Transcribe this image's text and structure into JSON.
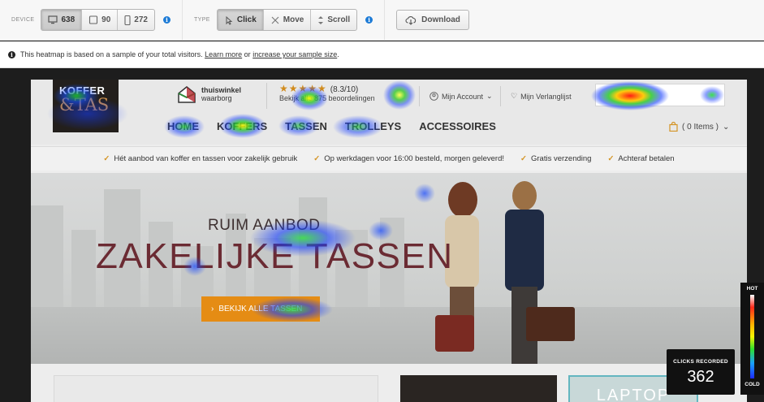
{
  "toolbar": {
    "device": {
      "label": "DEVICE",
      "options": [
        {
          "icon": "desktop-icon",
          "count": "638",
          "active": true
        },
        {
          "icon": "tablet-icon",
          "count": "90",
          "active": false
        },
        {
          "icon": "mobile-icon",
          "count": "272",
          "active": false
        }
      ]
    },
    "type": {
      "label": "TYPE",
      "options": [
        {
          "icon": "click-icon",
          "label": "Click",
          "active": true
        },
        {
          "icon": "move-icon",
          "label": "Move",
          "active": false
        },
        {
          "icon": "scroll-icon",
          "label": "Scroll",
          "active": false
        }
      ]
    },
    "download": {
      "icon": "cloud-download-icon",
      "label": "Download"
    }
  },
  "notice": {
    "text_before": "This heatmap is based on a sample of your total visitors.",
    "link1": "Learn more",
    "text_mid": "or",
    "link2": "increase your sample size",
    "text_after": "."
  },
  "site": {
    "logo_line1": "KOFFER",
    "logo_line2": "&TAS",
    "trust_line1": "thuiswinkel",
    "trust_line2": "waarborg",
    "rating_stars": "★★★★★",
    "rating_score": "(8.3/10)",
    "rating_sub": "Bekijk alle 875 beoordelingen",
    "account": "Mijn Account",
    "wishlist": "Mijn Verlanglijst",
    "nav": [
      "HOME",
      "KOFFERS",
      "TASSEN",
      "TROLLEYS",
      "ACCESSOIRES"
    ],
    "cart": "( 0 Items )",
    "usps": [
      "Hét aanbod van koffer en tassen voor zakelijk gebruik",
      "Op werkdagen voor 16:00 besteld, morgen geleverd!",
      "Gratis verzending",
      "Achteraf betalen"
    ],
    "hero_sub": "RUIM AANBOD",
    "hero_title": "ZAKELIJKE TASSEN",
    "hero_cta": "BEKIJK ALLE TASSEN",
    "tile_text": "LAPTOP"
  },
  "stats": {
    "clicks_label": "CLICKS RECORDED",
    "clicks_value": "362"
  },
  "legend": {
    "hot": "HOT",
    "cold": "COLD"
  },
  "colors": {
    "accent_blue": "#1d7bd6",
    "cta_orange": "#e58c14",
    "title_red": "#6b2b33",
    "check_orange": "#d49424"
  }
}
